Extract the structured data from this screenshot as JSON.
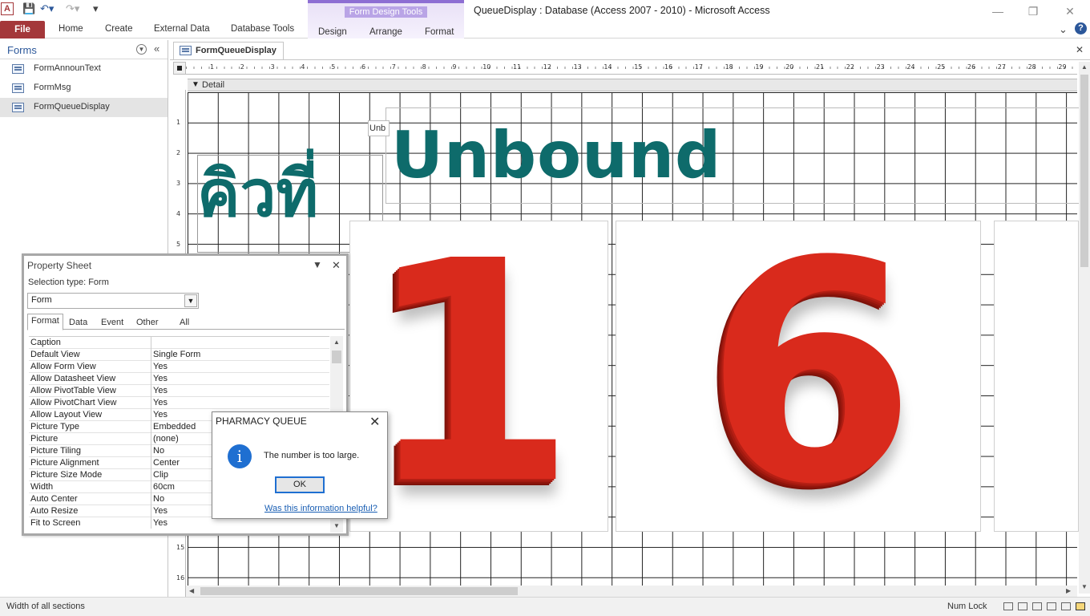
{
  "window": {
    "title": "QueueDisplay : Database (Access 2007 - 2010)  -  Microsoft Access",
    "app_icon": "A"
  },
  "ribbon": {
    "file_tab": "File",
    "tabs": [
      "Home",
      "Create",
      "External Data",
      "Database Tools"
    ],
    "context_group": "Form Design Tools",
    "context_tabs": [
      "Design",
      "Arrange",
      "Format"
    ]
  },
  "nav_pane": {
    "title": "Forms",
    "items": [
      "FormAnnounText",
      "FormMsg",
      "FormQueueDisplay"
    ],
    "selected": "FormQueueDisplay"
  },
  "document": {
    "tab_label": "FormQueueDisplay",
    "section_label": "Detail",
    "ruler_numbers": [
      "1",
      "2",
      "3",
      "4",
      "5",
      "6",
      "7",
      "8",
      "9",
      "10",
      "11",
      "12",
      "13",
      "14",
      "15",
      "16",
      "17",
      "18",
      "19",
      "20",
      "21",
      "22",
      "23",
      "24",
      "25",
      "26",
      "27",
      "28",
      "29"
    ],
    "vruler_numbers": [
      "1",
      "2",
      "3",
      "4",
      "5",
      "15",
      "16"
    ],
    "controls": {
      "small_label": "Unb",
      "big_label": "Unbound",
      "thai_label": "คิวที่",
      "digit_1": "1",
      "digit_2": "6"
    }
  },
  "property_sheet": {
    "title": "Property Sheet",
    "selection_type": "Selection type:  Form",
    "selected_object": "Form",
    "tabs": [
      "Format",
      "Data",
      "Event",
      "Other",
      "All"
    ],
    "active_tab": "Format",
    "properties": [
      {
        "name": "Caption",
        "value": ""
      },
      {
        "name": "Default View",
        "value": "Single Form"
      },
      {
        "name": "Allow Form View",
        "value": "Yes"
      },
      {
        "name": "Allow Datasheet View",
        "value": "Yes"
      },
      {
        "name": "Allow PivotTable View",
        "value": "Yes"
      },
      {
        "name": "Allow PivotChart View",
        "value": "Yes"
      },
      {
        "name": "Allow Layout View",
        "value": "Yes"
      },
      {
        "name": "Picture Type",
        "value": "Embedded"
      },
      {
        "name": "Picture",
        "value": "(none)"
      },
      {
        "name": "Picture Tiling",
        "value": "No"
      },
      {
        "name": "Picture Alignment",
        "value": "Center"
      },
      {
        "name": "Picture Size Mode",
        "value": "Clip"
      },
      {
        "name": "Width",
        "value": "60cm"
      },
      {
        "name": "Auto Center",
        "value": "No"
      },
      {
        "name": "Auto Resize",
        "value": "Yes"
      },
      {
        "name": "Fit to Screen",
        "value": "Yes"
      }
    ]
  },
  "dialog": {
    "title": "PHARMACY QUEUE",
    "message": "The number is too large.",
    "ok_label": "OK",
    "help_link": "Was this information helpful?"
  },
  "status_bar": {
    "left_text": "Width of all sections",
    "num_lock": "Num Lock"
  },
  "colors": {
    "file_tab": "#a4373a",
    "context_accent": "#8d6ed3",
    "label_teal": "#0e6b6b",
    "digit_red": "#d92a1c",
    "info_blue": "#1f6fd1"
  }
}
